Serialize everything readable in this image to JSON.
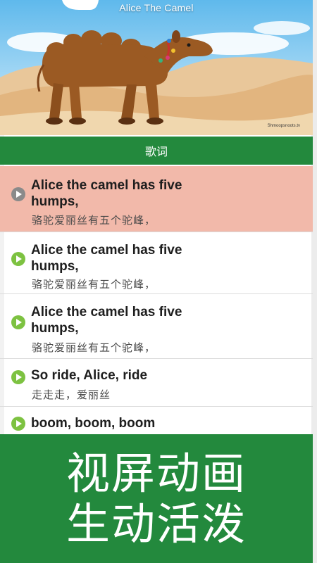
{
  "hero": {
    "title": "Alice The Camel",
    "watermark": "Shmoopsnoots.tv"
  },
  "section": {
    "title": "歌词"
  },
  "lyrics": [
    {
      "en": "Alice the camel has five humps,",
      "zh": "骆驼爱丽丝有五个驼峰，",
      "active": true
    },
    {
      "en": "Alice the camel has five humps,",
      "zh": "骆驼爱丽丝有五个驼峰，",
      "active": false
    },
    {
      "en": "Alice the camel has five humps,",
      "zh": "骆驼爱丽丝有五个驼峰，",
      "active": false
    },
    {
      "en": "So ride, Alice, ride",
      "zh": "走走走，爱丽丝",
      "active": false
    },
    {
      "en": "boom, boom, boom",
      "zh": "",
      "active": false
    }
  ],
  "promo": {
    "line1": "视屏动画",
    "line2": "生动活泼"
  },
  "colors": {
    "primary_green": "#23893d",
    "active_row": "#f2b9aa",
    "play_icon": "#7dc241"
  }
}
